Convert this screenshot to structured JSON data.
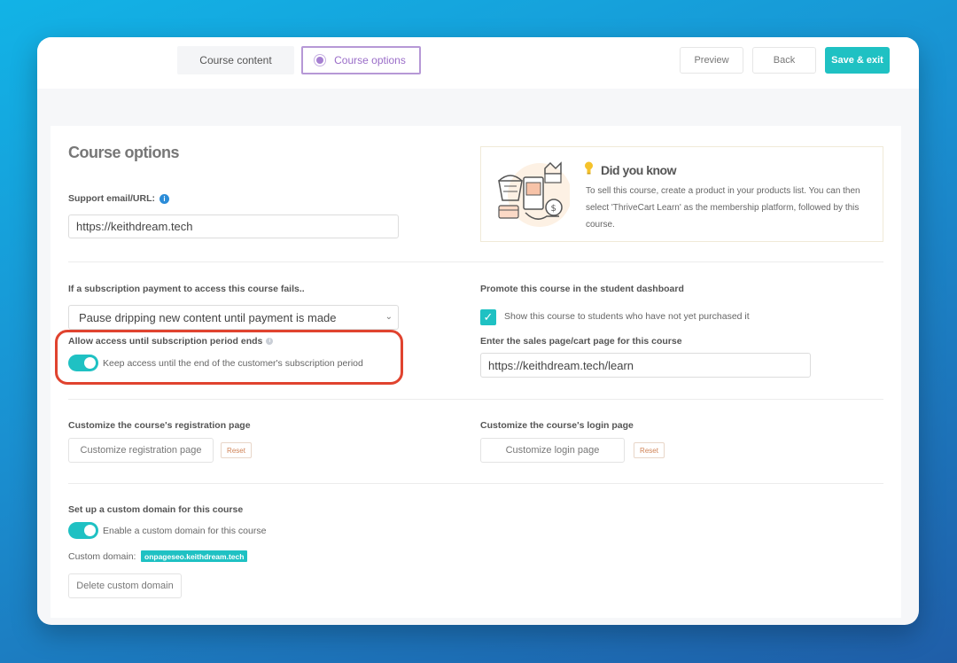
{
  "tabs": {
    "content": "Course content",
    "options": "Course options"
  },
  "top_buttons": {
    "preview": "Preview",
    "back": "Back",
    "save_exit": "Save & exit"
  },
  "page_title": "Course options",
  "support": {
    "label": "Support email/URL:",
    "value": "https://keithdream.tech"
  },
  "did_you_know": {
    "title": "Did you know",
    "body": "To sell this course, create a product in your products list. You can then select 'ThriveCart Learn' as the membership platform, followed by this course."
  },
  "subscription_fail": {
    "label": "If a subscription payment to access this course fails..",
    "selected": "Pause dripping new content until payment is made"
  },
  "allow_access": {
    "label": "Allow access until subscription period ends",
    "toggle_text": "Keep access until the end of the customer's subscription period"
  },
  "promote": {
    "label": "Promote this course in the student dashboard",
    "checkbox_text": "Show this course to students who have not yet purchased it"
  },
  "sales_page": {
    "label": "Enter the sales page/cart page for this course",
    "value": "https://keithdream.tech/learn"
  },
  "registration": {
    "label": "Customize the course's registration page",
    "button": "Customize registration page",
    "reset": "Reset"
  },
  "login": {
    "label": "Customize the course's login page",
    "button": "Customize login page",
    "reset": "Reset"
  },
  "custom_domain": {
    "label": "Set up a custom domain for this course",
    "toggle_text": "Enable a custom domain for this course",
    "domain_label": "Custom domain:",
    "domain_value": "onpageseo.keithdream.tech",
    "delete_button": "Delete custom domain"
  },
  "colors": {
    "accent": "#1fc1c3",
    "purple": "#a57fd1",
    "highlight": "#e0432f",
    "info": "#2b8cd8"
  }
}
